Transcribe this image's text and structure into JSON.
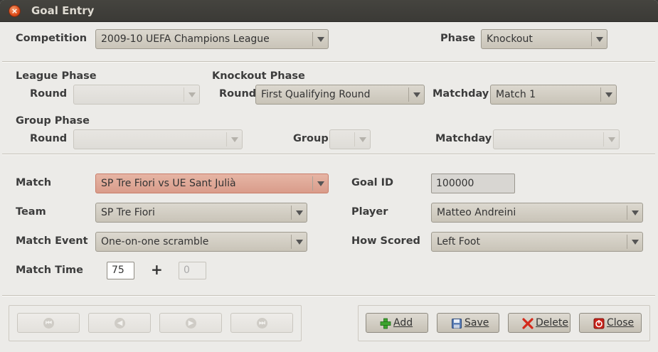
{
  "window": {
    "title": "Goal Entry"
  },
  "competition": {
    "label": "Competition",
    "value": "2009-10 UEFA Champions League"
  },
  "phase": {
    "label": "Phase",
    "value": "Knockout"
  },
  "league_phase": {
    "heading": "League Phase",
    "round_label": "Round",
    "round_value": ""
  },
  "knockout_phase": {
    "heading": "Knockout Phase",
    "round_label": "Round",
    "round_value": "First Qualifying Round",
    "matchday_label": "Matchday",
    "matchday_value": "Match 1"
  },
  "group_phase": {
    "heading": "Group Phase",
    "round_label": "Round",
    "round_value": "",
    "group_label": "Group",
    "group_value": "",
    "matchday_label": "Matchday",
    "matchday_value": ""
  },
  "match": {
    "label": "Match",
    "value": "SP Tre Fiori vs UE Sant Julià"
  },
  "goal_id": {
    "label": "Goal ID",
    "value": "100000"
  },
  "team": {
    "label": "Team",
    "value": "SP Tre Fiori"
  },
  "player": {
    "label": "Player",
    "value": "Matteo Andreini"
  },
  "match_event": {
    "label": "Match Event",
    "value": "One-on-one scramble"
  },
  "how_scored": {
    "label": "How Scored",
    "value": "Left Foot"
  },
  "match_time": {
    "label": "Match Time",
    "value": "75",
    "plus": "+",
    "added": "0"
  },
  "actions": {
    "add": "Add",
    "save": "Save",
    "delete": "Delete",
    "close": "Close"
  },
  "icons": {
    "close": "close-icon",
    "first": "first-record-icon",
    "prev": "previous-record-icon",
    "next": "next-record-icon",
    "last": "last-record-icon",
    "add": "add-icon",
    "save": "floppy-disk-icon",
    "delete": "delete-x-icon",
    "closeBtn": "power-icon"
  },
  "colors": {
    "titlebar": "#3b3a36",
    "window_bg": "#ecebe8",
    "error_combo": "#d99c8a",
    "close_button": "#df4b18"
  }
}
